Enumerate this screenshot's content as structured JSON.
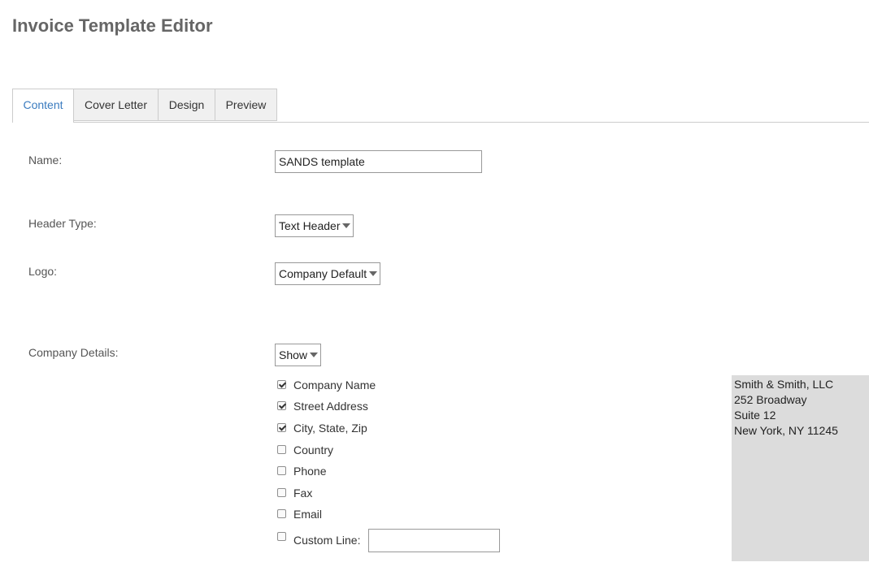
{
  "page": {
    "title": "Invoice Template Editor"
  },
  "tabs": [
    {
      "label": "Content",
      "active": true
    },
    {
      "label": "Cover Letter",
      "active": false
    },
    {
      "label": "Design",
      "active": false
    },
    {
      "label": "Preview",
      "active": false
    }
  ],
  "form": {
    "name": {
      "label": "Name:",
      "value": "SANDS template"
    },
    "header_type": {
      "label": "Header Type:",
      "value": "Text Header"
    },
    "logo": {
      "label": "Logo:",
      "value": "Company Default"
    },
    "company_details": {
      "label": "Company Details:",
      "value": "Show"
    }
  },
  "details_checkboxes": [
    {
      "label": "Company Name",
      "checked": true
    },
    {
      "label": "Street Address",
      "checked": true
    },
    {
      "label": "City, State, Zip",
      "checked": true
    },
    {
      "label": "Country",
      "checked": false
    },
    {
      "label": "Phone",
      "checked": false
    },
    {
      "label": "Fax",
      "checked": false
    },
    {
      "label": "Email",
      "checked": false
    },
    {
      "label": "Custom Line:",
      "checked": false,
      "value": ""
    }
  ],
  "company_preview": {
    "lines": [
      "Smith & Smith, LLC",
      "252 Broadway",
      "Suite 12",
      "New York, NY 11245"
    ]
  },
  "colors": {
    "active_tab": "#3a7bbf",
    "preview_background": "#dcdcdc",
    "title": "#666666"
  },
  "icons": {
    "dropdown": "caret-down-icon",
    "checkbox": "checkbox-icon"
  }
}
